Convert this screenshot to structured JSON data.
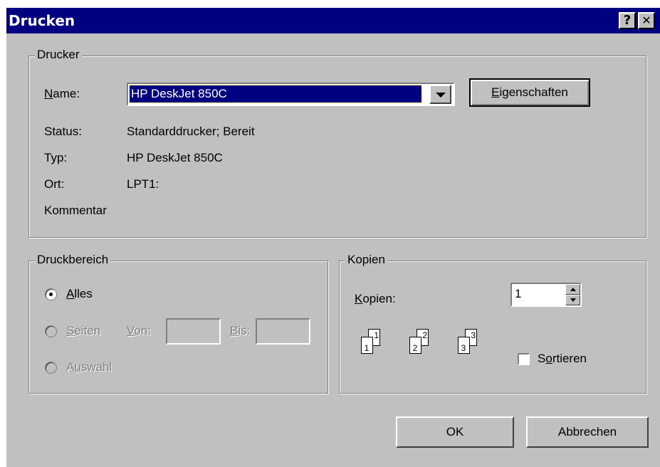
{
  "window": {
    "title": "Drucken"
  },
  "titlebar_buttons": {
    "help": "?",
    "close": "✕"
  },
  "printer_group": {
    "legend": "Drucker",
    "name_label_u": "N",
    "name_label_rest": "ame:",
    "name_value": "HP DeskJet 850C",
    "properties_button_u": "E",
    "properties_button_rest": "igenschaften",
    "status_label": "Status:",
    "status_value": "Standarddrucker; Bereit",
    "type_label": "Typ:",
    "type_value": "HP DeskJet 850C",
    "location_label": "Ort:",
    "location_value": "LPT1:",
    "comment_label": "Kommentar"
  },
  "range_group": {
    "legend": "Druckbereich",
    "all_u": "A",
    "all_rest": "lles",
    "pages_u": "S",
    "pages_rest": "eiten",
    "from_u": "V",
    "from_rest": "on:",
    "to_u": "B",
    "to_rest": "is:",
    "selection_pre": "A",
    "selection_u": "u",
    "selection_rest": "swahl",
    "selected": "all"
  },
  "copies_group": {
    "legend": "Kopien",
    "copies_label_u": "K",
    "copies_label_rest": "opien:",
    "copies_value": "1",
    "collate_pre": "S",
    "collate_u": "o",
    "collate_rest": "rtieren",
    "collate_checked": false,
    "icon_pages": [
      "1",
      "2",
      "3"
    ]
  },
  "buttons": {
    "ok": "OK",
    "cancel": "Abbrechen"
  }
}
